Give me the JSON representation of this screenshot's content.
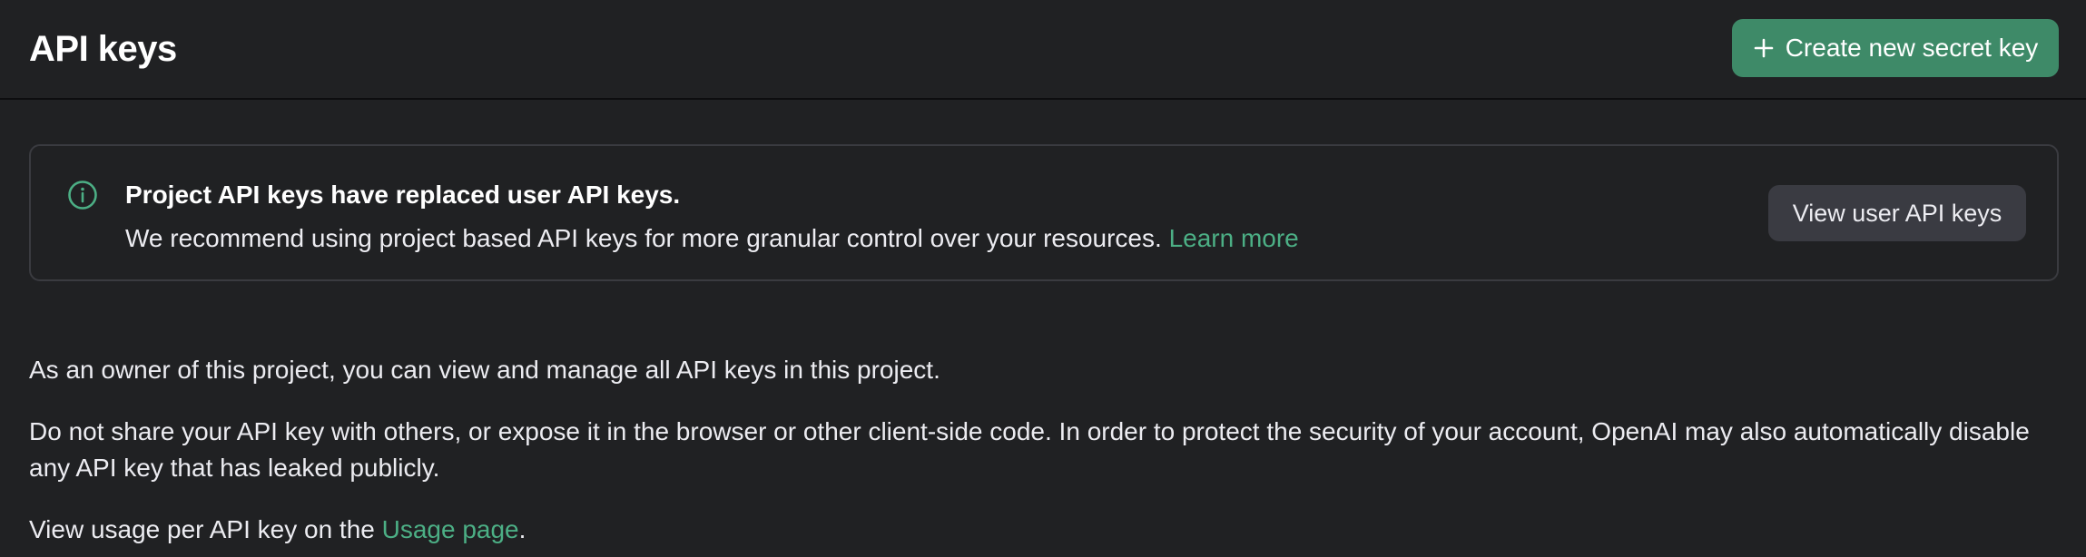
{
  "header": {
    "title": "API keys",
    "create_button_label": "Create new secret key"
  },
  "notice": {
    "icon": "info-icon",
    "title": "Project API keys have replaced user API keys.",
    "body": "We recommend using project based API keys for more granular control over your resources.",
    "link_label": "Learn more",
    "button_label": "View user API keys"
  },
  "content": {
    "paragraph_1": "As an owner of this project, you can view and manage all API keys in this project.",
    "paragraph_2": "Do not share your API key with others, or expose it in the browser or other client-side code. In order to protect the security of your account, OpenAI may also automatically disable any API key that has leaked publicly.",
    "paragraph_3_prefix": "View usage per API key on the",
    "usage_link_label": "Usage page",
    "paragraph_3_suffix": "."
  },
  "colors": {
    "background": "#202123",
    "accent": "#3e8a68",
    "link": "#4caf85",
    "secondary_button": "#3a3b42"
  }
}
